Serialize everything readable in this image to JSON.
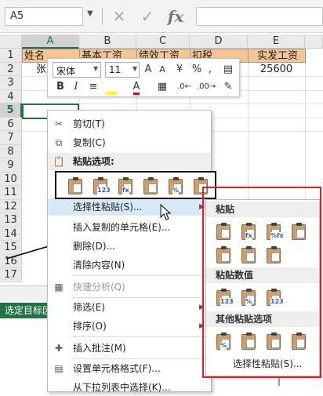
{
  "formula_bar": {
    "name_box": "A5",
    "cancel_icon": "close-icon",
    "enter_icon": "check-icon",
    "fx_label": "fx",
    "formula": ""
  },
  "grid": {
    "columns": [
      "A",
      "B",
      "C",
      "D",
      "E"
    ],
    "rows": [
      "1",
      "2",
      "3",
      "4",
      "5",
      "6",
      "7",
      "8",
      "9",
      "10",
      "11",
      "12",
      "13",
      "14",
      "15",
      "16",
      "17"
    ],
    "selected_column": "A",
    "selected_row": "5",
    "row1": [
      "姓名",
      "基本工资",
      "绩效工资",
      "扣税",
      "实发工资"
    ],
    "row2": [
      "张",
      "",
      "",
      "",
      "25600"
    ]
  },
  "status_text": "选定目标区",
  "mini_toolbar": {
    "font": "宋体",
    "size": "11",
    "grow_font": "A",
    "shrink_font": "A",
    "currency": "¥",
    "percent": "%",
    "thousands": ",",
    "bold": "B",
    "italic": "I",
    "font_color": "A"
  },
  "context_menu": {
    "cut": "剪切(T)",
    "copy": "复制(C)",
    "paste_options": "粘贴选项:",
    "paste_special": "选择性粘贴(S)...",
    "insert_copied": "插入复制的单元格(E)...",
    "delete": "删除(D)...",
    "clear": "清除内容(N)",
    "quick_analysis": "快速分析(Q)",
    "filter": "筛选(E)",
    "sort": "排序(O)",
    "insert_comment": "插入批注(M)",
    "format_cells": "设置单元格格式(F)...",
    "pick_list": "从下拉列表中选择(K)..."
  },
  "paste_icons": [
    "paste-icon",
    "paste-values-icon",
    "paste-formulas-icon",
    "paste-transpose-icon",
    "paste-formatting-icon",
    "paste-link-icon"
  ],
  "paste_icon_tags": [
    "",
    "123",
    "fx",
    "",
    "%",
    ""
  ],
  "submenu": {
    "paste": "粘贴",
    "paste_values": "粘贴数值",
    "other_options": "其他粘贴选项",
    "paste_special": "选择性粘贴(S)..."
  },
  "submenu_icons": {
    "paste": [
      "paste-icon",
      "paste-formulas-icon",
      "paste-formulas-number-format-icon",
      "paste-keep-source-formatting-icon",
      "paste-no-borders-icon",
      "paste-keep-column-widths-icon",
      "paste-transpose-icon"
    ],
    "values": [
      "paste-values-icon",
      "paste-values-number-format-icon",
      "paste-values-source-format-icon"
    ],
    "other": [
      "paste-formatting-icon",
      "paste-link-icon",
      "paste-picture-icon",
      "paste-linked-picture-icon"
    ]
  },
  "submenu_icon_tags": {
    "paste": [
      "",
      "fx",
      "%fx",
      "",
      "",
      "",
      ""
    ],
    "values": [
      "123",
      "%",
      "123"
    ],
    "other": [
      "%",
      "",
      "",
      ""
    ]
  },
  "colors": {
    "header_fill": "#f6c592",
    "excel_green": "#217346",
    "highlight_red": "#e51c24",
    "menu_hover": "#d7e8f7"
  }
}
